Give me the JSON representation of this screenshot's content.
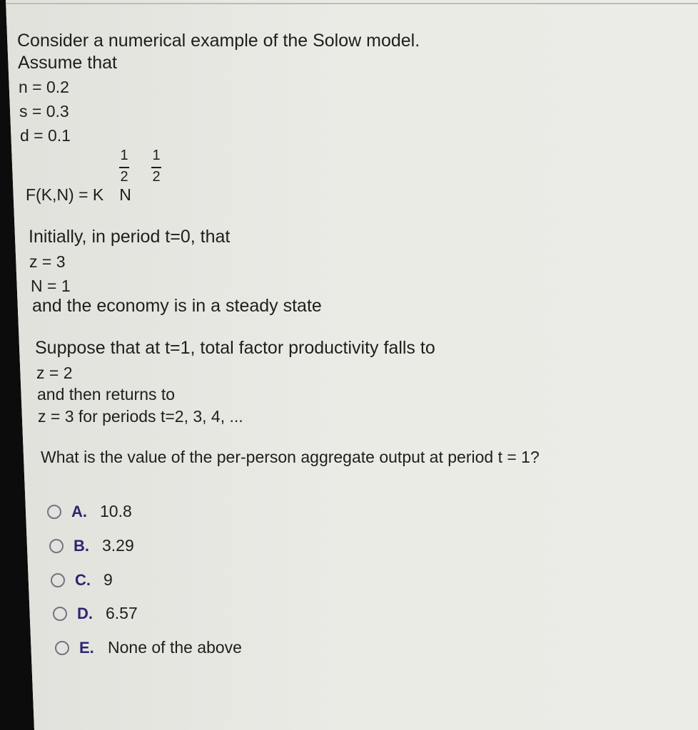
{
  "question": {
    "intro_lines": [
      "Consider a numerical example of the Solow model.",
      "Assume that",
      "n = 0.2",
      "s = 0.3",
      "d = 0.1"
    ],
    "formula": {
      "lhs": "F(K,N) = K",
      "var2": "N",
      "exp1_num": "1",
      "exp1_den": "2",
      "exp2_num": "1",
      "exp2_den": "2"
    },
    "initial_lines": [
      "Initially, in period t=0, that",
      "z = 3",
      "N = 1",
      "and the economy is in a steady state"
    ],
    "shock_lines": [
      "Suppose that at t=1, total factor productivity falls to",
      "z = 2",
      "and then returns to",
      "z = 3 for periods t=2, 3, 4, ..."
    ],
    "prompt": "What is the value of the per-person aggregate output at period t = 1?"
  },
  "options": [
    {
      "letter": "A.",
      "text": "10.8",
      "selected": false
    },
    {
      "letter": "B.",
      "text": "3.29",
      "selected": false
    },
    {
      "letter": "C.",
      "text": "9",
      "selected": false
    },
    {
      "letter": "D.",
      "text": "6.57",
      "selected": false
    },
    {
      "letter": "E.",
      "text": "None of the above",
      "selected": false
    }
  ],
  "colors": {
    "option_letter": "#2c2572",
    "radio_border": "#747480",
    "background": "#e9e9e4"
  }
}
